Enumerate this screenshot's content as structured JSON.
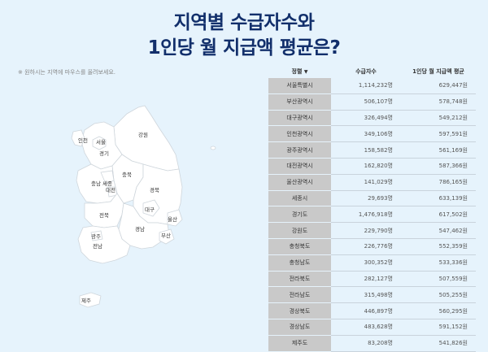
{
  "title": {
    "line1": "지역별 수급자수와",
    "line2": "1인당 월 지급액 평균은?"
  },
  "hint": "※ 원하시는 지역에 마우스를 올려보세요.",
  "table": {
    "headers": {
      "region": "정렬",
      "sort_icon": "triangle-down-icon",
      "count": "수급자수",
      "avg": "1인당 월 지급액 평균"
    },
    "rows": [
      {
        "region": "서울특별시",
        "count": "1,114,232명",
        "avg": "629,447원"
      },
      {
        "region": "부산광역시",
        "count": "506,107명",
        "avg": "578,748원"
      },
      {
        "region": "대구광역시",
        "count": "326,494명",
        "avg": "549,212원"
      },
      {
        "region": "인천광역시",
        "count": "349,106명",
        "avg": "597,591원"
      },
      {
        "region": "광주광역시",
        "count": "158,582명",
        "avg": "561,169원"
      },
      {
        "region": "대전광역시",
        "count": "162,820명",
        "avg": "587,366원"
      },
      {
        "region": "울산광역시",
        "count": "141,029명",
        "avg": "786,165원"
      },
      {
        "region": "세종시",
        "count": "29,693명",
        "avg": "633,139원"
      },
      {
        "region": "경기도",
        "count": "1,476,918명",
        "avg": "617,502원"
      },
      {
        "region": "강원도",
        "count": "229,790명",
        "avg": "547,462원"
      },
      {
        "region": "충청북도",
        "count": "226,776명",
        "avg": "552,359원"
      },
      {
        "region": "충청남도",
        "count": "300,352명",
        "avg": "533,336원"
      },
      {
        "region": "전라북도",
        "count": "282,127명",
        "avg": "507,559원"
      },
      {
        "region": "전라남도",
        "count": "315,498명",
        "avg": "505,255원"
      },
      {
        "region": "경상북도",
        "count": "446,897명",
        "avg": "560,295원"
      },
      {
        "region": "경상남도",
        "count": "483,628명",
        "avg": "591,152원"
      },
      {
        "region": "제주도",
        "count": "83,208명",
        "avg": "541,826원"
      }
    ]
  },
  "map": {
    "labels": {
      "incheon": "인천",
      "seoul": "서울",
      "gyeonggi": "경기",
      "gangwon": "강원",
      "chungnam": "충남",
      "sejong": "세종",
      "chungbuk": "충북",
      "daejeon": "대전",
      "gyeongbuk": "경북",
      "jeonbuk": "전북",
      "daegu": "대구",
      "ulsan": "울산",
      "gwangju": "광주",
      "gyeongnam": "경남",
      "busan": "부산",
      "jeonnam": "전남",
      "jeju": "제주"
    }
  }
}
